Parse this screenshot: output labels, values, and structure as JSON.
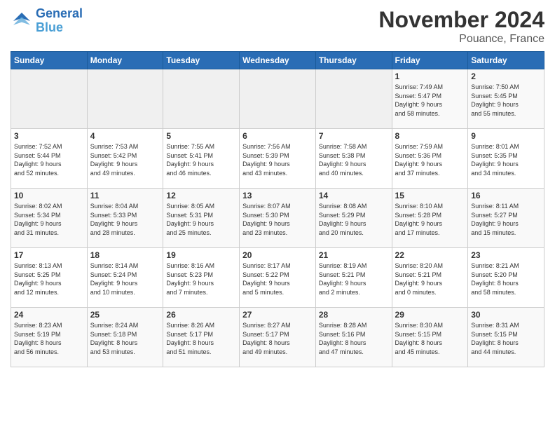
{
  "header": {
    "logo_line1": "General",
    "logo_line2": "Blue",
    "month": "November 2024",
    "location": "Pouance, France"
  },
  "weekdays": [
    "Sunday",
    "Monday",
    "Tuesday",
    "Wednesday",
    "Thursday",
    "Friday",
    "Saturday"
  ],
  "weeks": [
    [
      {
        "day": "",
        "info": ""
      },
      {
        "day": "",
        "info": ""
      },
      {
        "day": "",
        "info": ""
      },
      {
        "day": "",
        "info": ""
      },
      {
        "day": "",
        "info": ""
      },
      {
        "day": "1",
        "info": "Sunrise: 7:49 AM\nSunset: 5:47 PM\nDaylight: 9 hours\nand 58 minutes."
      },
      {
        "day": "2",
        "info": "Sunrise: 7:50 AM\nSunset: 5:45 PM\nDaylight: 9 hours\nand 55 minutes."
      }
    ],
    [
      {
        "day": "3",
        "info": "Sunrise: 7:52 AM\nSunset: 5:44 PM\nDaylight: 9 hours\nand 52 minutes."
      },
      {
        "day": "4",
        "info": "Sunrise: 7:53 AM\nSunset: 5:42 PM\nDaylight: 9 hours\nand 49 minutes."
      },
      {
        "day": "5",
        "info": "Sunrise: 7:55 AM\nSunset: 5:41 PM\nDaylight: 9 hours\nand 46 minutes."
      },
      {
        "day": "6",
        "info": "Sunrise: 7:56 AM\nSunset: 5:39 PM\nDaylight: 9 hours\nand 43 minutes."
      },
      {
        "day": "7",
        "info": "Sunrise: 7:58 AM\nSunset: 5:38 PM\nDaylight: 9 hours\nand 40 minutes."
      },
      {
        "day": "8",
        "info": "Sunrise: 7:59 AM\nSunset: 5:36 PM\nDaylight: 9 hours\nand 37 minutes."
      },
      {
        "day": "9",
        "info": "Sunrise: 8:01 AM\nSunset: 5:35 PM\nDaylight: 9 hours\nand 34 minutes."
      }
    ],
    [
      {
        "day": "10",
        "info": "Sunrise: 8:02 AM\nSunset: 5:34 PM\nDaylight: 9 hours\nand 31 minutes."
      },
      {
        "day": "11",
        "info": "Sunrise: 8:04 AM\nSunset: 5:33 PM\nDaylight: 9 hours\nand 28 minutes."
      },
      {
        "day": "12",
        "info": "Sunrise: 8:05 AM\nSunset: 5:31 PM\nDaylight: 9 hours\nand 25 minutes."
      },
      {
        "day": "13",
        "info": "Sunrise: 8:07 AM\nSunset: 5:30 PM\nDaylight: 9 hours\nand 23 minutes."
      },
      {
        "day": "14",
        "info": "Sunrise: 8:08 AM\nSunset: 5:29 PM\nDaylight: 9 hours\nand 20 minutes."
      },
      {
        "day": "15",
        "info": "Sunrise: 8:10 AM\nSunset: 5:28 PM\nDaylight: 9 hours\nand 17 minutes."
      },
      {
        "day": "16",
        "info": "Sunrise: 8:11 AM\nSunset: 5:27 PM\nDaylight: 9 hours\nand 15 minutes."
      }
    ],
    [
      {
        "day": "17",
        "info": "Sunrise: 8:13 AM\nSunset: 5:25 PM\nDaylight: 9 hours\nand 12 minutes."
      },
      {
        "day": "18",
        "info": "Sunrise: 8:14 AM\nSunset: 5:24 PM\nDaylight: 9 hours\nand 10 minutes."
      },
      {
        "day": "19",
        "info": "Sunrise: 8:16 AM\nSunset: 5:23 PM\nDaylight: 9 hours\nand 7 minutes."
      },
      {
        "day": "20",
        "info": "Sunrise: 8:17 AM\nSunset: 5:22 PM\nDaylight: 9 hours\nand 5 minutes."
      },
      {
        "day": "21",
        "info": "Sunrise: 8:19 AM\nSunset: 5:21 PM\nDaylight: 9 hours\nand 2 minutes."
      },
      {
        "day": "22",
        "info": "Sunrise: 8:20 AM\nSunset: 5:21 PM\nDaylight: 9 hours\nand 0 minutes."
      },
      {
        "day": "23",
        "info": "Sunrise: 8:21 AM\nSunset: 5:20 PM\nDaylight: 8 hours\nand 58 minutes."
      }
    ],
    [
      {
        "day": "24",
        "info": "Sunrise: 8:23 AM\nSunset: 5:19 PM\nDaylight: 8 hours\nand 56 minutes."
      },
      {
        "day": "25",
        "info": "Sunrise: 8:24 AM\nSunset: 5:18 PM\nDaylight: 8 hours\nand 53 minutes."
      },
      {
        "day": "26",
        "info": "Sunrise: 8:26 AM\nSunset: 5:17 PM\nDaylight: 8 hours\nand 51 minutes."
      },
      {
        "day": "27",
        "info": "Sunrise: 8:27 AM\nSunset: 5:17 PM\nDaylight: 8 hours\nand 49 minutes."
      },
      {
        "day": "28",
        "info": "Sunrise: 8:28 AM\nSunset: 5:16 PM\nDaylight: 8 hours\nand 47 minutes."
      },
      {
        "day": "29",
        "info": "Sunrise: 8:30 AM\nSunset: 5:15 PM\nDaylight: 8 hours\nand 45 minutes."
      },
      {
        "day": "30",
        "info": "Sunrise: 8:31 AM\nSunset: 5:15 PM\nDaylight: 8 hours\nand 44 minutes."
      }
    ]
  ]
}
